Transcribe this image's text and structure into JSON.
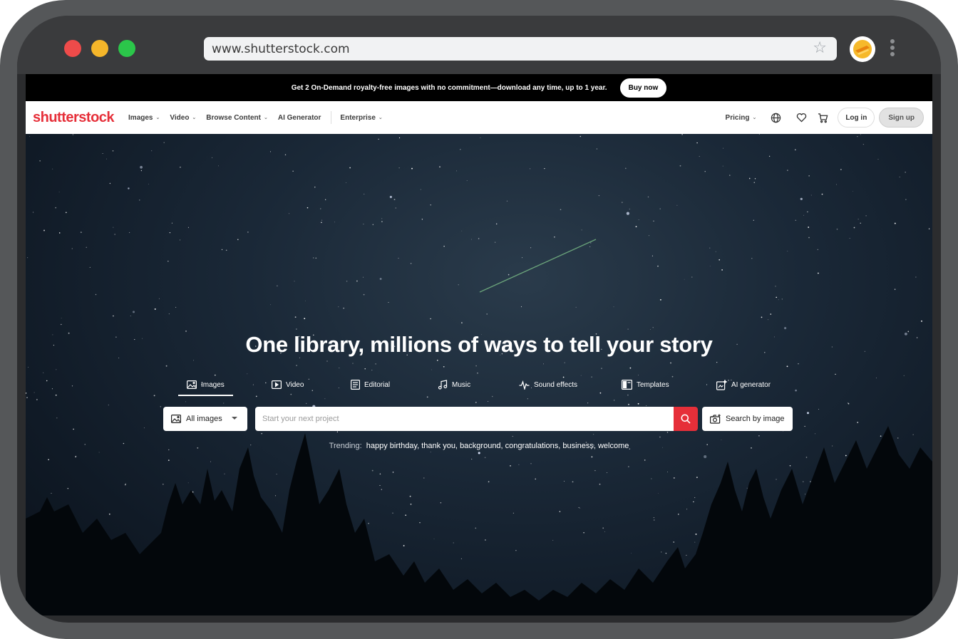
{
  "browser": {
    "url": "www.shutterstock.com",
    "bookmark_icon": "star-icon",
    "menu_icon": "kebab-menu-icon"
  },
  "promo": {
    "text": "Get 2 On-Demand royalty-free images with no commitment—download any time, up to 1 year.",
    "cta": "Buy now"
  },
  "nav": {
    "logo": "shutterstock",
    "items": [
      {
        "label": "Images",
        "dropdown": true
      },
      {
        "label": "Video",
        "dropdown": true
      },
      {
        "label": "Browse Content",
        "dropdown": true
      },
      {
        "label": "AI Generator",
        "dropdown": false
      },
      {
        "label": "Enterprise",
        "dropdown": true
      }
    ],
    "pricing": "Pricing",
    "login": "Log in",
    "signup": "Sign up",
    "icons": [
      "globe-icon",
      "heart-icon",
      "cart-icon"
    ]
  },
  "hero": {
    "title": "One library, millions of ways to tell your story",
    "tabs": [
      {
        "label": "Images",
        "icon": "image-icon",
        "active": true
      },
      {
        "label": "Video",
        "icon": "video-icon",
        "active": false
      },
      {
        "label": "Editorial",
        "icon": "editorial-icon",
        "active": false
      },
      {
        "label": "Music",
        "icon": "music-icon",
        "active": false
      },
      {
        "label": "Sound effects",
        "icon": "sound-wave-icon",
        "active": false
      },
      {
        "label": "Templates",
        "icon": "templates-icon",
        "active": false
      },
      {
        "label": "AI generator",
        "icon": "ai-generator-icon",
        "active": false
      }
    ],
    "search": {
      "category": "All images",
      "placeholder": "Start your next project",
      "search_by_image": "Search by image"
    },
    "trending": {
      "label": "Trending:",
      "terms": [
        "happy birthday,",
        "thank you,",
        "background,",
        "congratulations,",
        "business,",
        "welcome"
      ]
    }
  },
  "colors": {
    "brand_red": "#e62f39",
    "promo_bg": "#000000",
    "nav_bg": "#ffffff",
    "traffic_red": "#ee4b4a",
    "traffic_yellow": "#f5b62a",
    "traffic_green": "#2bc64a"
  }
}
